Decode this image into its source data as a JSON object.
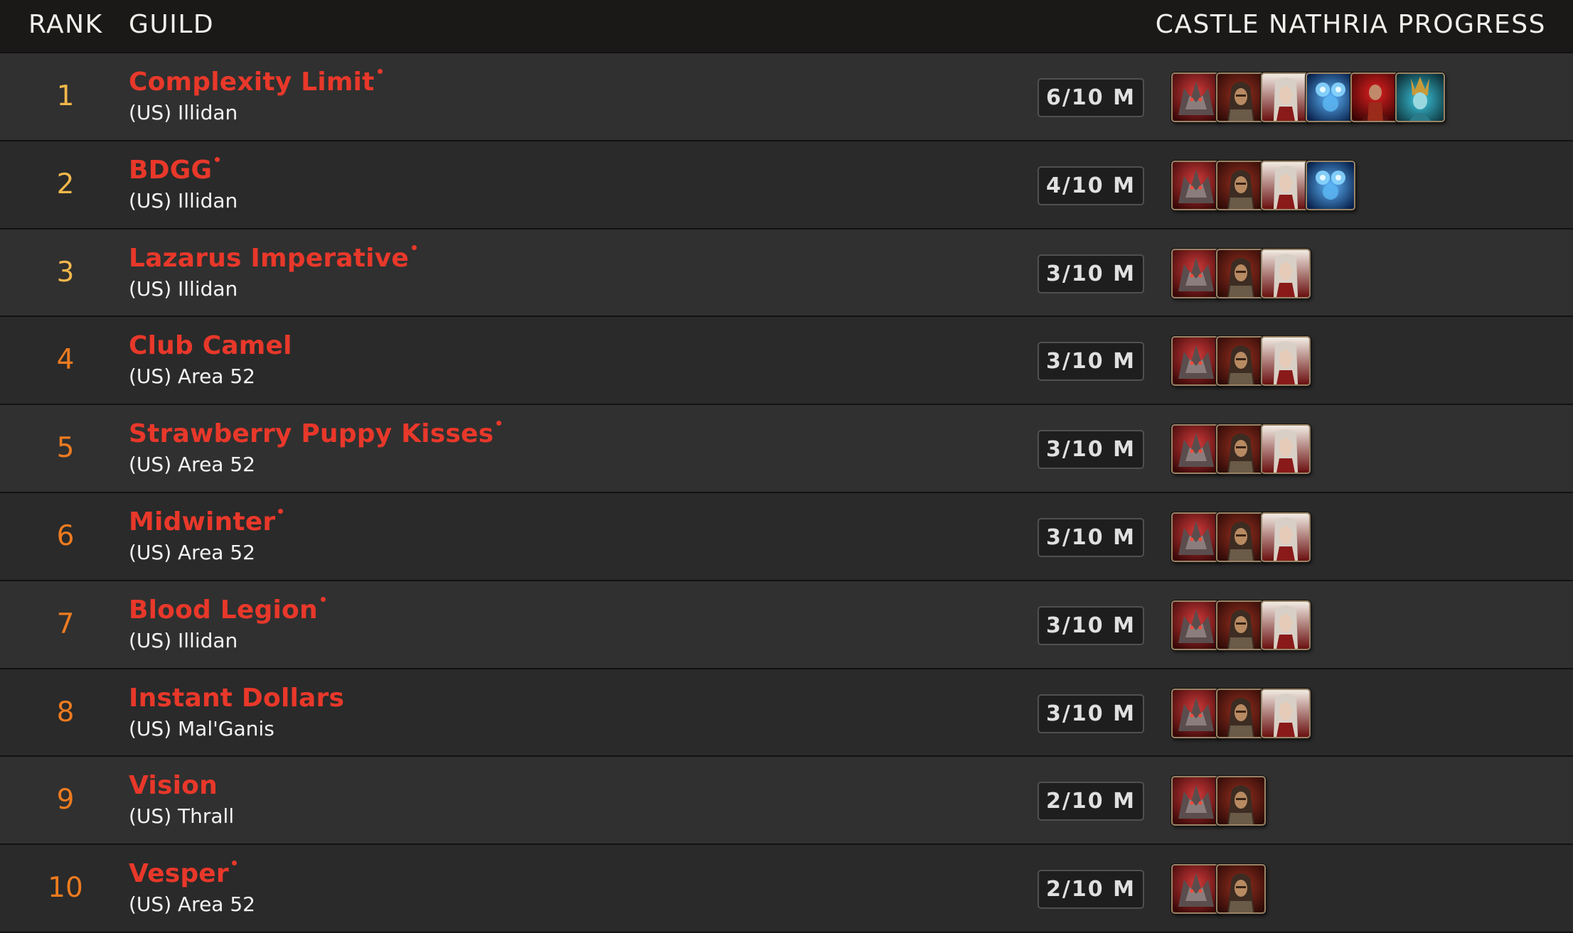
{
  "header": {
    "rank_label": "RANK",
    "guild_label": "GUILD",
    "progress_label": "CASTLE NATHRIA PROGRESS"
  },
  "colors": {
    "guild_name": "#e8382a",
    "rank_high": "#f2b84b",
    "rank_low": "#ee7b20",
    "header_bg": "#1b1818",
    "row_odd": "#303030",
    "row_even": "#2a2a2a"
  },
  "boss_icons": [
    "shriekwing-icon",
    "huntsman-altimor-icon",
    "sun-kings-salvation-icon",
    "artificer-xymox-icon",
    "hungering-destroyer-icon",
    "lady-inerva-darkvein-icon"
  ],
  "guilds": [
    {
      "rank": "1",
      "name": "Complexity Limit",
      "marked": true,
      "realm": "(US) Illidan",
      "progress": "6/10 M",
      "bosses_killed": 6
    },
    {
      "rank": "2",
      "name": "BDGG",
      "marked": true,
      "realm": "(US) Illidan",
      "progress": "4/10 M",
      "bosses_killed": 4
    },
    {
      "rank": "3",
      "name": "Lazarus Imperative",
      "marked": true,
      "realm": "(US) Illidan",
      "progress": "3/10 M",
      "bosses_killed": 3
    },
    {
      "rank": "4",
      "name": "Club Camel",
      "marked": false,
      "realm": "(US) Area 52",
      "progress": "3/10 M",
      "bosses_killed": 3
    },
    {
      "rank": "5",
      "name": "Strawberry Puppy Kisses",
      "marked": true,
      "realm": "(US) Area 52",
      "progress": "3/10 M",
      "bosses_killed": 3
    },
    {
      "rank": "6",
      "name": "Midwinter",
      "marked": true,
      "realm": "(US) Area 52",
      "progress": "3/10 M",
      "bosses_killed": 3
    },
    {
      "rank": "7",
      "name": "Blood Legion",
      "marked": true,
      "realm": "(US) Illidan",
      "progress": "3/10 M",
      "bosses_killed": 3
    },
    {
      "rank": "8",
      "name": "Instant Dollars",
      "marked": false,
      "realm": "(US) Mal'Ganis",
      "progress": "3/10 M",
      "bosses_killed": 3
    },
    {
      "rank": "9",
      "name": "Vision",
      "marked": false,
      "realm": "(US) Thrall",
      "progress": "2/10 M",
      "bosses_killed": 2
    },
    {
      "rank": "10",
      "name": "Vesper",
      "marked": true,
      "realm": "(US) Area 52",
      "progress": "2/10 M",
      "bosses_killed": 2
    }
  ]
}
